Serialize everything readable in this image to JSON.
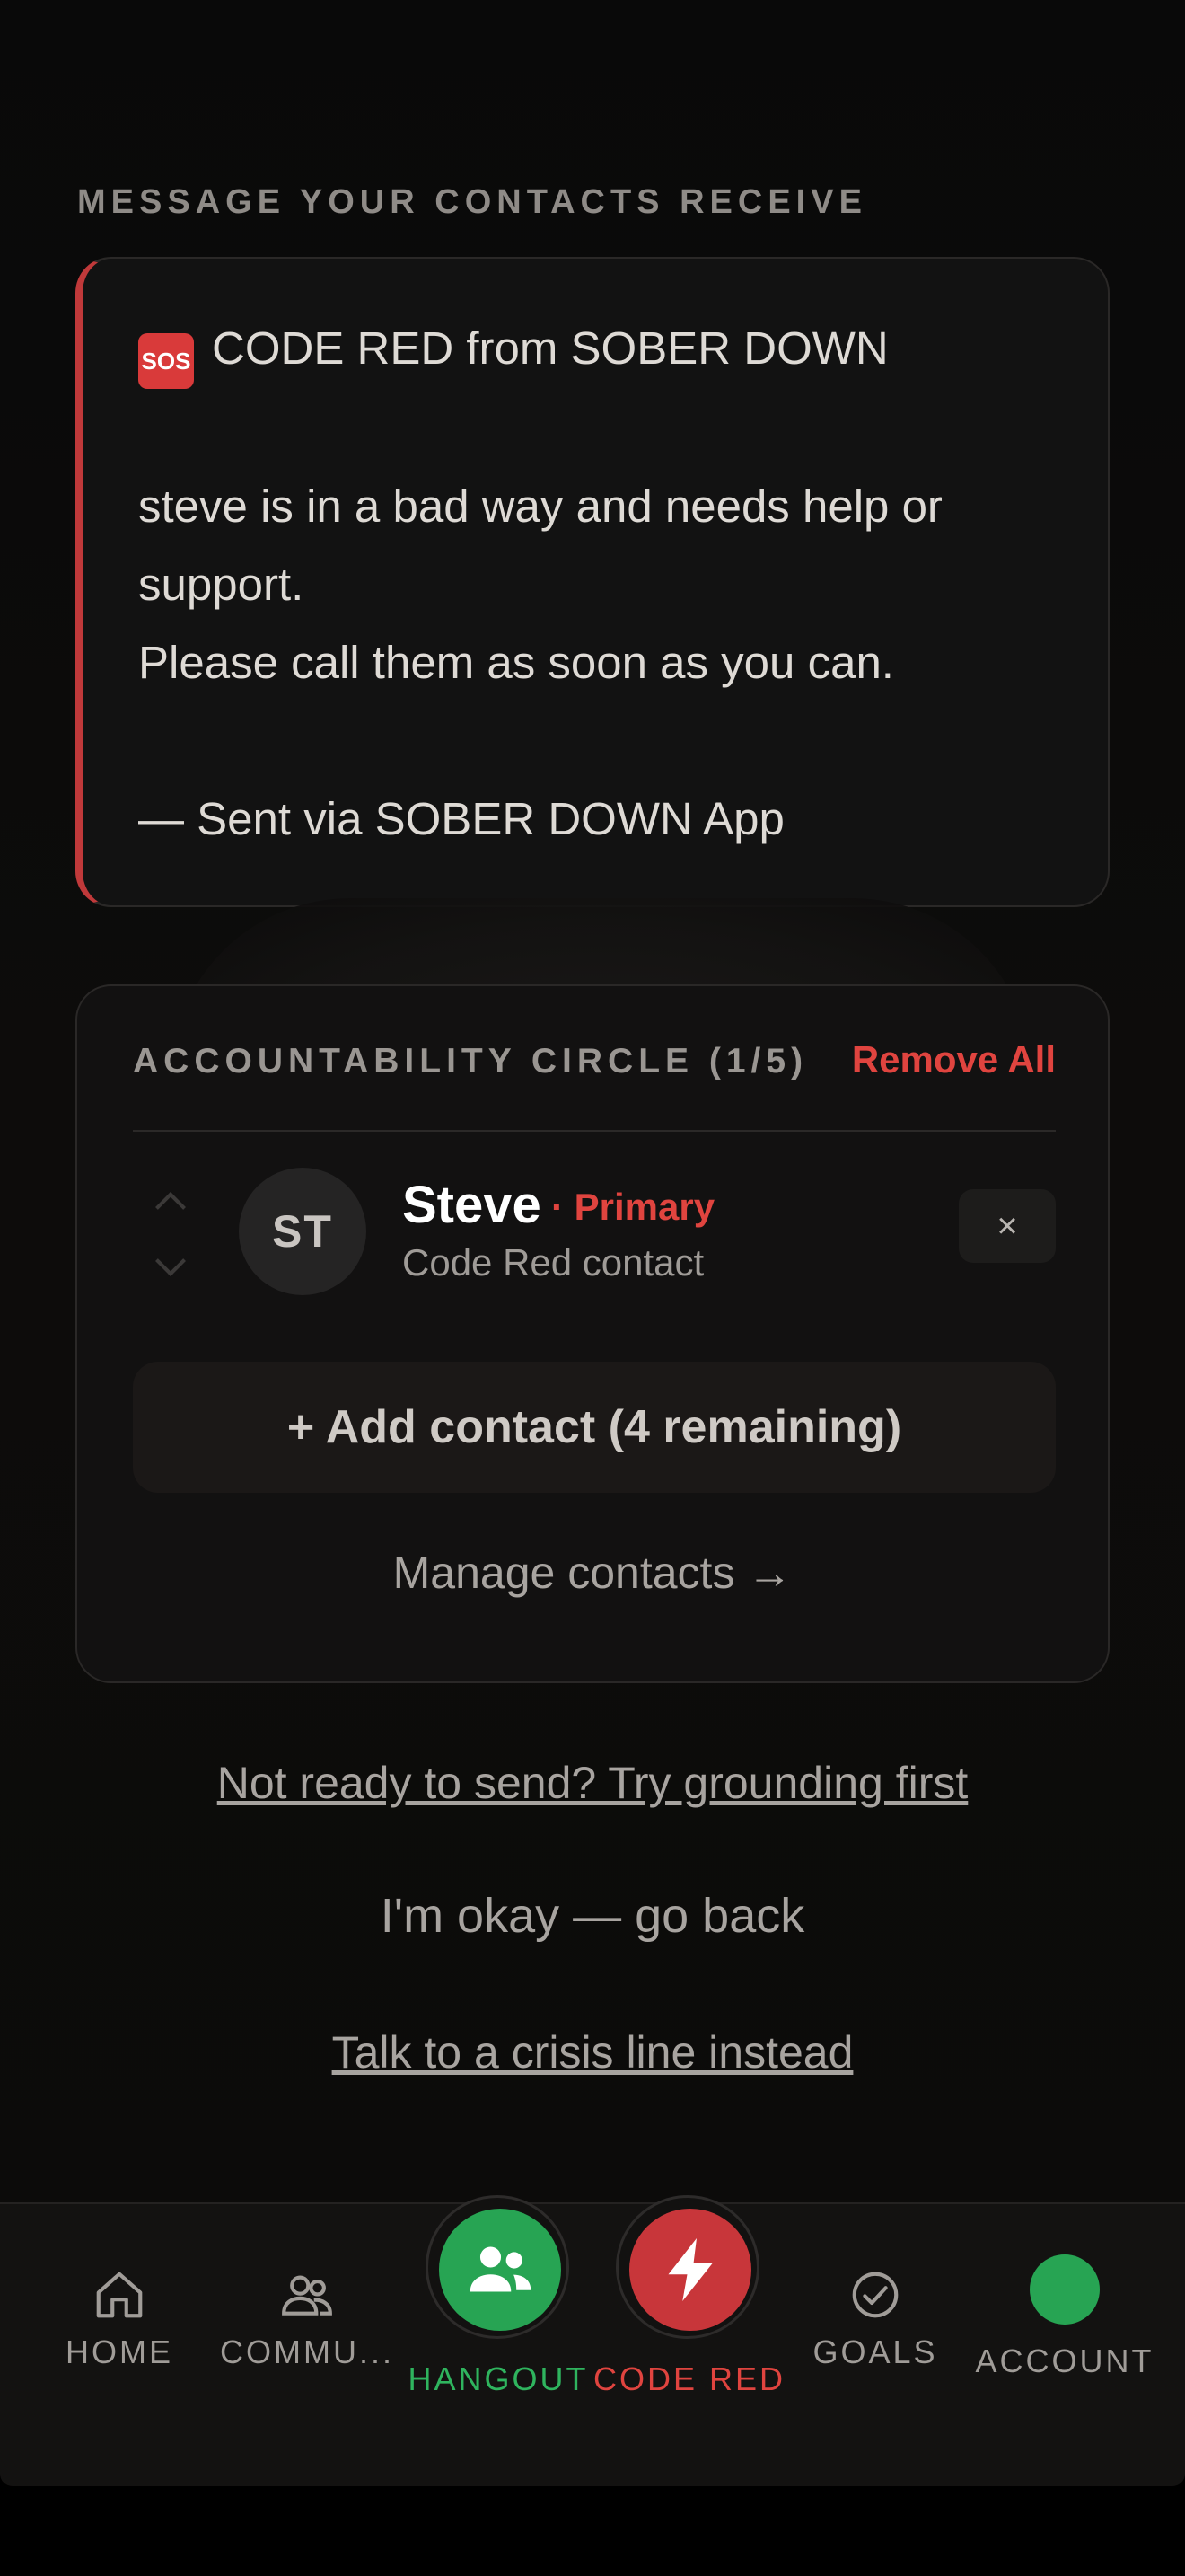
{
  "section_label": "MESSAGE YOUR CONTACTS RECEIVE",
  "message": {
    "sos_badge": "SOS",
    "header": "CODE RED from SOBER DOWN",
    "line1": "steve is in a bad way and needs help or",
    "line2": "support.",
    "line3": "Please call them as soon as you can.",
    "signature": "— Sent via SOBER DOWN App"
  },
  "circle": {
    "title": "ACCOUNTABILITY CIRCLE (1/5)",
    "remove_all": "Remove All",
    "contacts": [
      {
        "initials": "ST",
        "name": "Steve",
        "badge": "· Primary",
        "subtitle": "Code Red contact",
        "remove": "×"
      }
    ],
    "add_contact": "+ Add contact (4 remaining)",
    "manage": "Manage contacts →"
  },
  "links": {
    "grounding": "Not ready to send? Try grounding first",
    "okay": "I'm okay — go back",
    "crisis": "Talk to a crisis line instead"
  },
  "tabs": {
    "home": "HOME",
    "community": "COMMU...",
    "hangout": "HANGOUT",
    "code_red": "CODE RED",
    "goals": "GOALS",
    "account": "ACCOUNT"
  },
  "colors": {
    "accent_red": "#e0443f",
    "accent_green": "#27a453",
    "background": "#0b0a0a"
  }
}
